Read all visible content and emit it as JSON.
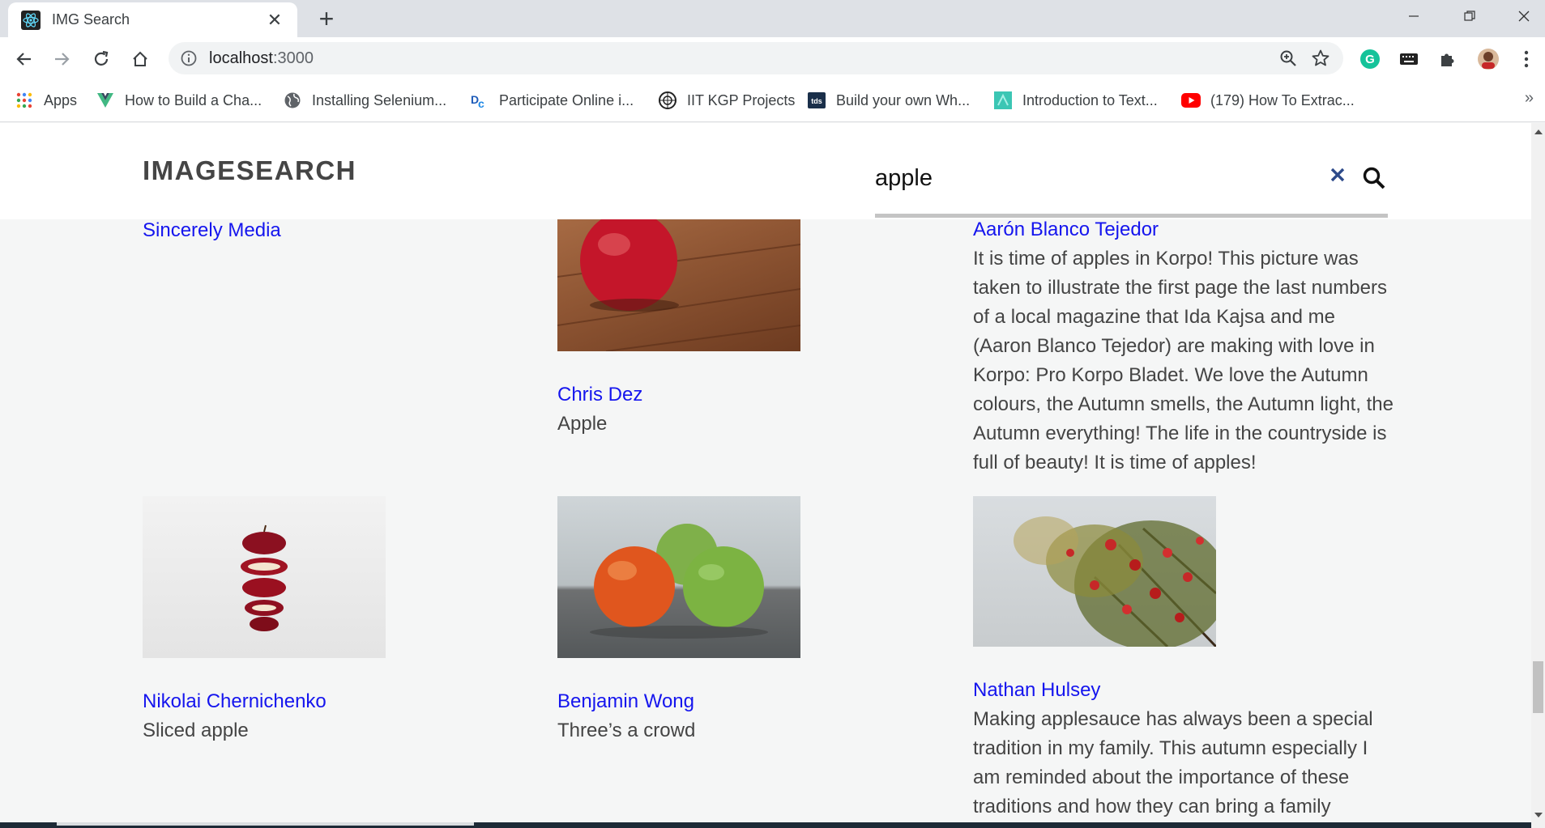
{
  "browser": {
    "tab_title": "IMG Search",
    "url_host": "localhost",
    "url_port": ":3000",
    "bookmarks": [
      {
        "label": "Apps",
        "icon": "apps-grid-icon"
      },
      {
        "label": "How to Build a Cha...",
        "icon": "vue-logo-icon"
      },
      {
        "label": "Installing Selenium...",
        "icon": "globe-icon"
      },
      {
        "label": "Participate Online i...",
        "icon": "dc-logo-icon"
      },
      {
        "label": "IIT KGP Projects",
        "icon": "iit-logo-icon"
      },
      {
        "label": "Build your own Wh...",
        "icon": "tds-logo-icon"
      },
      {
        "label": "Introduction to Text...",
        "icon": "teal-logo-icon"
      },
      {
        "label": "(179) How To Extrac...",
        "icon": "youtube-icon"
      }
    ]
  },
  "app": {
    "brand": "IMAGESEARCH",
    "search_value": "apple"
  },
  "results": [
    {
      "author": "Sincerely Media",
      "desc": ""
    },
    {
      "author": "Chris Dez",
      "desc": "Apple"
    },
    {
      "author": "Aarón Blanco Tejedor",
      "desc": "It is time of apples in Korpo! This picture was taken to illustrate the first page the last numbers of a local magazine that Ida Kajsa and me (Aaron Blanco Tejedor) are making with love in Korpo: Pro Korpo Bladet. We love the Autumn colours, the Autumn smells, the Autumn light, the Autumn everything! The life in the countryside is full of beauty! It is time of apples!"
    },
    {
      "author": "Nikolai Chernichenko",
      "desc": "Sliced apple"
    },
    {
      "author": "Benjamin Wong",
      "desc": "Three’s a crowd"
    },
    {
      "author": "Nathan Hulsey",
      "desc": "Making applesauce has always been a special tradition in my family. This autumn especially I am reminded about the importance of these traditions and how they can bring a family"
    }
  ],
  "colors": {
    "link": "#1515ee",
    "text": "#444444",
    "brand": "#454545",
    "clear_icon": "#2d4a8a",
    "page_bg": "#f5f6f6"
  }
}
